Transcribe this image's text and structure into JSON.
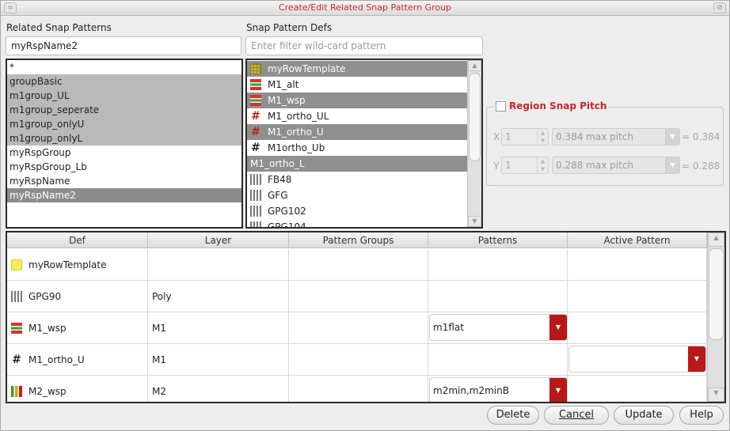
{
  "window": {
    "title": "Create/Edit Related Snap Pattern Group",
    "menu_glyph": "=",
    "close_glyph": "⊘"
  },
  "related": {
    "label": "Related Snap Patterns",
    "name_value": "myRspName2",
    "items": [
      {
        "label": "*",
        "state": "normal"
      },
      {
        "label": "groupBasic",
        "state": "sel"
      },
      {
        "label": "m1group_UL",
        "state": "sel"
      },
      {
        "label": "m1group_seperate",
        "state": "sel"
      },
      {
        "label": "m1group_onlyU",
        "state": "sel"
      },
      {
        "label": "m1group_onlyL",
        "state": "sel"
      },
      {
        "label": "myRspGroup",
        "state": "normal"
      },
      {
        "label": "myRspGroup_Lb",
        "state": "normal"
      },
      {
        "label": "myRspName",
        "state": "normal"
      },
      {
        "label": "myRspName2",
        "state": "dark"
      }
    ]
  },
  "defs": {
    "label": "Snap Pattern Defs",
    "filter_placeholder": "Enter filter wild-card pattern",
    "items": [
      {
        "label": "myRowTemplate",
        "icon": "grid",
        "sel": true
      },
      {
        "label": "M1_alt",
        "icon": "stripes-rg",
        "sel": false
      },
      {
        "label": "M1_wsp",
        "icon": "stripes-rg",
        "sel": true
      },
      {
        "label": "M1_ortho_UL",
        "icon": "hash-red",
        "sel": false
      },
      {
        "label": "M1_ortho_U",
        "icon": "hash-red",
        "sel": true
      },
      {
        "label": "M1ortho_Ub",
        "icon": "hash",
        "sel": false
      },
      {
        "label": "M1_ortho_L",
        "icon": "none",
        "sel": true
      },
      {
        "label": "FB48",
        "icon": "bars-gray",
        "sel": false
      },
      {
        "label": "GFG",
        "icon": "bars-gray",
        "sel": false
      },
      {
        "label": "GPG102",
        "icon": "bars-gray",
        "sel": false
      },
      {
        "label": "GPG104",
        "icon": "bars-gray",
        "sel": false
      }
    ]
  },
  "region": {
    "label": "Region Snap Pitch",
    "x_axis": "X",
    "x_value": "1",
    "x_pitch": "0.384 max pitch",
    "x_result": "= 0.384",
    "y_axis": "Y",
    "y_value": "1",
    "y_pitch": "0.288 max pitch",
    "y_result": "= 0.288"
  },
  "table": {
    "headers": [
      "Def",
      "Layer",
      "Pattern Groups",
      "Patterns",
      "Active Pattern"
    ],
    "rows": [
      {
        "def": "myRowTemplate",
        "icon": "yellow",
        "layer": "",
        "groups": "",
        "patterns": "",
        "active": ""
      },
      {
        "def": "GPG90",
        "icon": "bars-gray",
        "layer": "Poly",
        "groups": "",
        "patterns": "",
        "active": ""
      },
      {
        "def": "M1_wsp",
        "icon": "stripes-rg",
        "layer": "M1",
        "groups": "",
        "patterns": "m1flat",
        "active": ""
      },
      {
        "def": "M1_ortho_U",
        "icon": "hash-black",
        "layer": "M1",
        "groups": "",
        "patterns": "",
        "active": ""
      },
      {
        "def": "M2_wsp",
        "icon": "bars-multi",
        "layer": "M2",
        "groups": "",
        "patterns": "m2min,m2minB",
        "active": ""
      }
    ]
  },
  "buttons": {
    "delete": "Delete",
    "cancel": "Cancel",
    "update": "Update",
    "help": "Help"
  }
}
